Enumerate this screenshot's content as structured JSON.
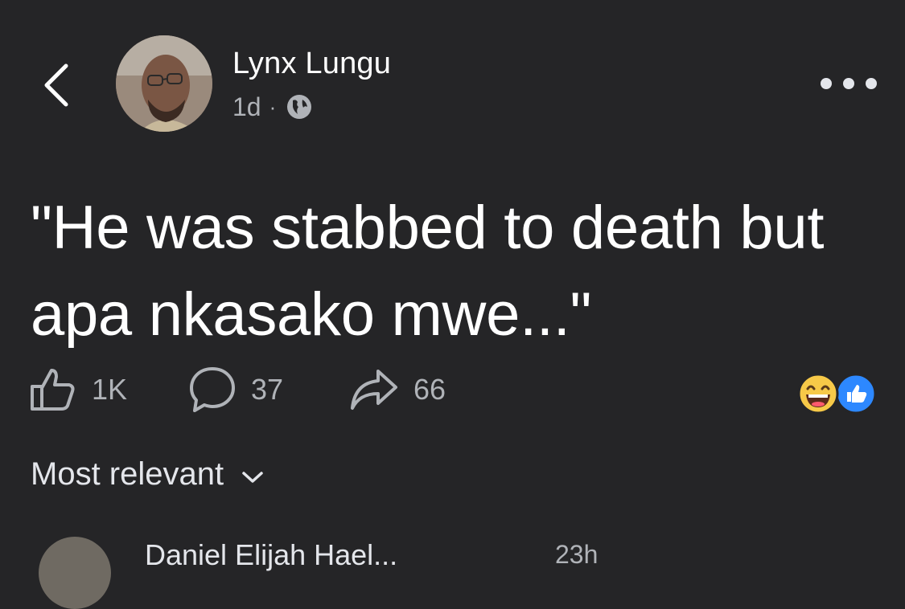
{
  "header": {
    "author_name": "Lynx Lungu",
    "timestamp": "1d",
    "separator": "·",
    "privacy_icon": "globe-icon",
    "more_icon": "more-options-icon",
    "back_icon": "chevron-left-icon"
  },
  "post": {
    "text": "\"He was stabbed to death but apa nkasako mwe...\""
  },
  "actions": {
    "like_count": "1K",
    "comment_count": "37",
    "share_count": "66"
  },
  "reactions": [
    "laughing-emoji-icon",
    "like-reaction-icon"
  ],
  "comments": {
    "sort_label": "Most relevant",
    "first_comment_author_partial": "Daniel Elijah Hael...",
    "first_comment_time_partial": "23h"
  },
  "colors": {
    "background": "#252527",
    "text_primary": "#ffffff",
    "text_secondary": "#b0b3b8",
    "like_blue": "#2d88ff",
    "emoji_yellow": "#f7c948"
  }
}
